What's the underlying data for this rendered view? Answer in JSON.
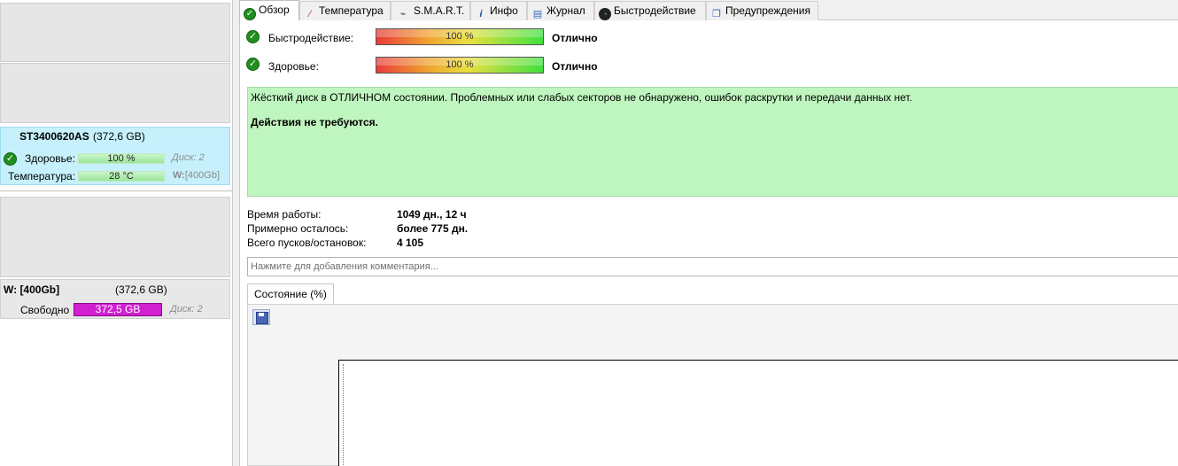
{
  "left_panel": {
    "disk": {
      "model": "ST3400620AS",
      "size": "(372,6 GB)",
      "health_label": "Здоровье:",
      "health_value": "100 %",
      "disk_num": "Диск: 2",
      "temp_label": "Температура:",
      "temp_value": "28 °C",
      "drive_letter": "W:",
      "drive_name": "[400Gb]"
    },
    "volume": {
      "name": "W: [400Gb]",
      "size": "(372,6 GB)",
      "free_label": "Свободно",
      "free_value": "372,5 GB",
      "disk_num": "Диск: 2",
      "free_bar_color": "#d020d0"
    }
  },
  "tabs": [
    {
      "label": "Обзор",
      "icon": "check-icon",
      "active": true
    },
    {
      "label": "Температура",
      "icon": "thermometer-icon",
      "active": false
    },
    {
      "label": "S.M.A.R.T.",
      "icon": "smart-icon",
      "active": false
    },
    {
      "label": "Инфо",
      "icon": "info-icon",
      "active": false
    },
    {
      "label": "Журнал",
      "icon": "log-icon",
      "active": false
    },
    {
      "label": "Быстродействие",
      "icon": "speedometer-icon",
      "active": false
    },
    {
      "label": "Предупреждения",
      "icon": "warnings-icon",
      "active": false
    }
  ],
  "overview": {
    "performance_label": "Быстродействие:",
    "performance_value": "100 %",
    "performance_status": "Отлично",
    "performance_percent": 100,
    "health_label": "Здоровье:",
    "health_value": "100 %",
    "health_status": "Отлично",
    "health_percent": 100,
    "summary_text": "Жёсткий диск в ОТЛИЧНОМ состоянии. Проблемных или слабых секторов не обнаружено, ошибок раскрутки и передачи данных нет.",
    "summary_action": "Действия не требуются.",
    "stats": [
      {
        "label": "Время работы:",
        "value": "1049 дн., 12 ч"
      },
      {
        "label": "Примерно осталось:",
        "value": "более 775 дн."
      },
      {
        "label": "Всего пусков/остановок:",
        "value": "4 105"
      }
    ],
    "comment_placeholder": "Нажмите для добавления комментария...",
    "subtab_label": "Состояние (%)"
  },
  "colors": {
    "selected_disk_bg": "#c6f0fb",
    "summary_bg": "#bff5bf",
    "ok_green": "#1f8f1f"
  }
}
